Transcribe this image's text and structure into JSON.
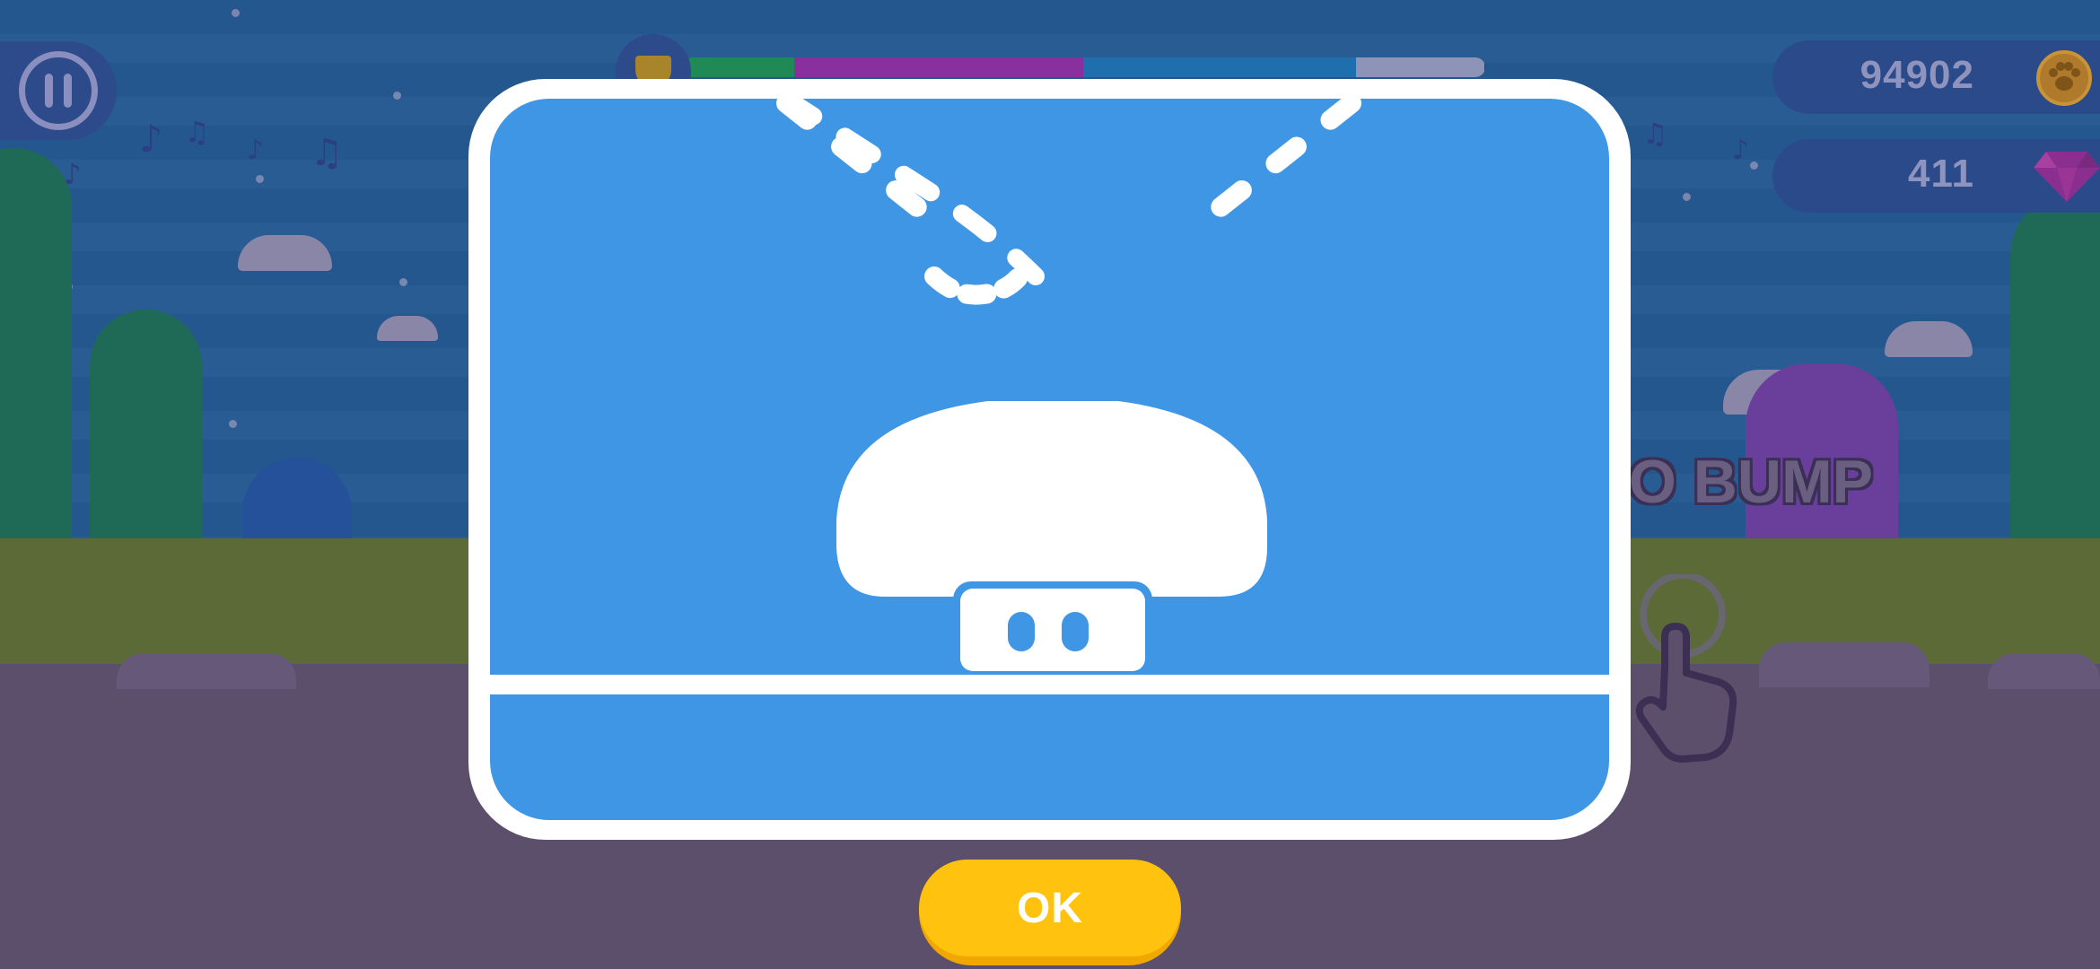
{
  "hud": {
    "pause_icon": "pause-icon",
    "progress": {
      "trophy_icon": "trophy-icon",
      "segments": [
        {
          "color": "#1f8a55",
          "fraction": 0.14
        },
        {
          "color": "#8a2f9e",
          "fraction": 0.36
        },
        {
          "color": "#1f6fae",
          "fraction": 0.34
        },
        {
          "color": "#8e93b8",
          "fraction": 0.16
        }
      ]
    },
    "coins": {
      "value": "94902",
      "icon": "paw-coin-icon"
    },
    "gems": {
      "value": "411",
      "icon": "gem-icon"
    }
  },
  "background": {
    "instruction_text": "O BUMP",
    "hand_icon": "tap-hand-icon"
  },
  "dialog": {
    "illustration_icon": "mushroom-bump-icon",
    "caption": "",
    "ok_label": "OK",
    "colors": {
      "frame": "#ffffff",
      "panel": "#3f96e5",
      "button": "#ffc20e"
    }
  }
}
